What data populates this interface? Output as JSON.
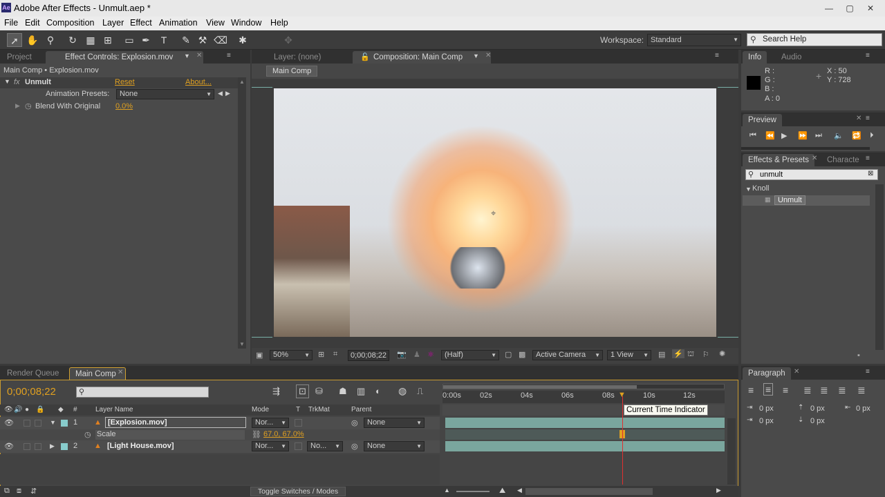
{
  "window": {
    "title": "Adobe After Effects - Unmult.aep *",
    "app_icon": "Ae"
  },
  "menu": [
    "File",
    "Edit",
    "Composition",
    "Layer",
    "Effect",
    "Animation",
    "View",
    "Window",
    "Help"
  ],
  "toolbar": {
    "workspace_label": "Workspace:",
    "workspace_value": "Standard",
    "search_placeholder": "Search Help"
  },
  "left_panel": {
    "tabs": [
      "Project",
      "Effect Controls: Explosion.mov"
    ],
    "breadcrumb": "Main Comp • Explosion.mov",
    "effect_name": "Unmult",
    "reset": "Reset",
    "about": "About...",
    "presets_label": "Animation Presets:",
    "presets_value": "None",
    "param_label": "Blend With Original",
    "param_value": "0.0%"
  },
  "comp_panel": {
    "tabs": [
      "Layer: (none)",
      "Composition: Main Comp"
    ],
    "comp_button": "Main Comp",
    "zoom": "50%",
    "timecode": "0;00;08;22",
    "resolution": "(Half)",
    "camera": "Active Camera",
    "views": "1 View"
  },
  "info_panel": {
    "tabs": [
      "Info",
      "Audio"
    ],
    "r": "R :",
    "g": "G :",
    "b": "B :",
    "a": "A : 0",
    "x": "X : 50",
    "y": "Y : 728"
  },
  "preview_panel": {
    "tab": "Preview"
  },
  "effects_panel": {
    "tabs": [
      "Effects & Presets",
      "Characte"
    ],
    "search_value": "unmult",
    "category": "Knoll",
    "item": "Unmult"
  },
  "timeline": {
    "tabs": [
      "Render Queue",
      "Main Comp"
    ],
    "timecode": "0;00;08;22",
    "columns": {
      "num": "#",
      "layer_name": "Layer Name",
      "mode": "Mode",
      "t": "T",
      "trkmat": "TrkMat",
      "parent": "Parent"
    },
    "ruler": [
      "0:00s",
      "02s",
      "04s",
      "06s",
      "08s",
      "10s",
      "12s"
    ],
    "tooltip": "Current Time Indicator",
    "toggle": "Toggle Switches / Modes",
    "layers": [
      {
        "num": "1",
        "name": "[Explosion.mov]",
        "mode": "Nor...",
        "parent": "None"
      },
      {
        "num": "2",
        "name": "[Light House.mov]",
        "mode": "Nor...",
        "trkmat": "No...",
        "parent": "None"
      }
    ],
    "scale": {
      "label": "Scale",
      "value": "67.0, 67.0%"
    }
  },
  "paragraph_panel": {
    "tab": "Paragraph",
    "px_values": [
      "0 px",
      "0 px",
      "0 px",
      "0 px",
      "0 px"
    ]
  }
}
